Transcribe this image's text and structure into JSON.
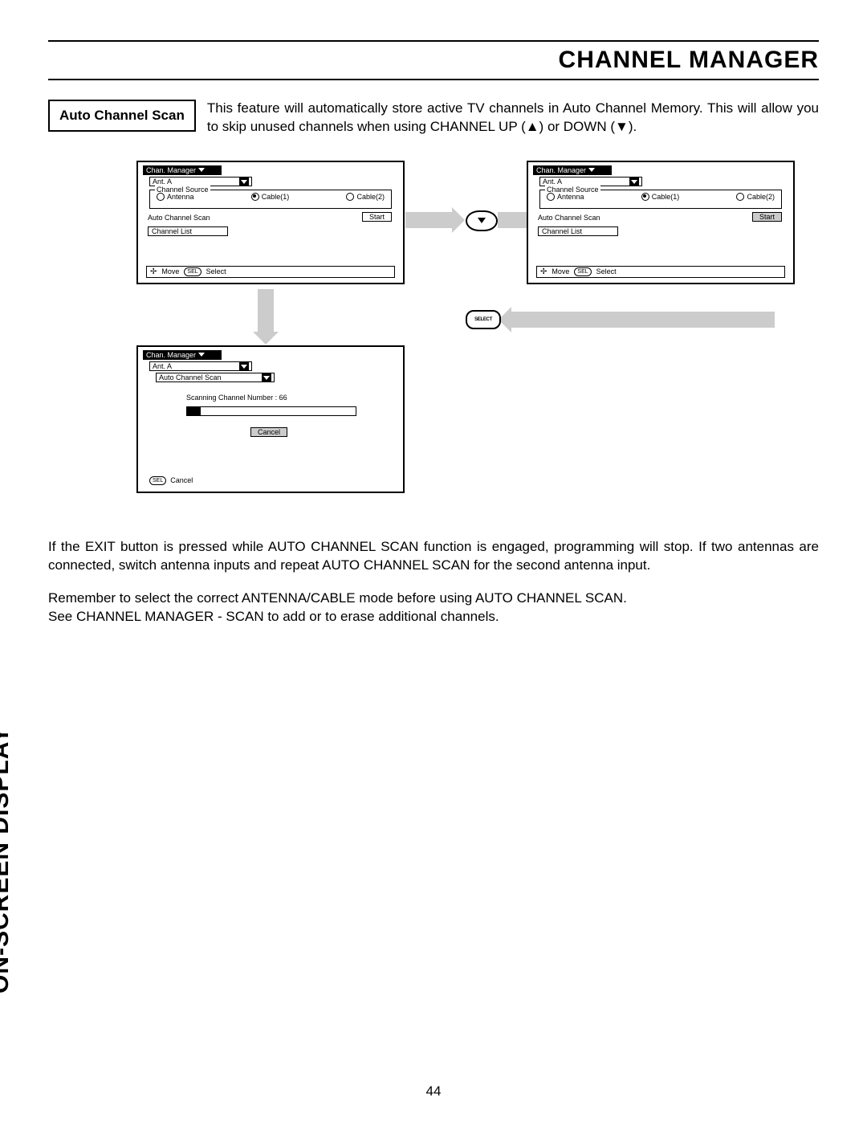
{
  "page": {
    "title": "CHANNEL MANAGER",
    "side_label": "ON-SCREEN DISPLAY",
    "page_number": "44"
  },
  "intro": {
    "feature_label": "Auto Channel Scan",
    "text": "This feature will automatically store active TV channels in Auto Channel Memory.  This will allow you to skip unused channels when using CHANNEL UP (▲) or DOWN (▼)."
  },
  "osd_common": {
    "tab": "Chan. Manager",
    "ant": "Ant. A",
    "source_legend": "Channel Source",
    "radios": {
      "antenna": "Antenna",
      "cable1": "Cable(1)",
      "cable2": "Cable(2)"
    },
    "auto_scan": "Auto Channel Scan",
    "start": "Start",
    "ch_list": "Channel List",
    "nav_move": "Move",
    "nav_sel": "SEL",
    "nav_select": "Select",
    "nav_cancel": "Cancel"
  },
  "osd3": {
    "sub2": "Auto Channel Scan",
    "scan_line": "Scanning Channel Number : 66",
    "cancel": "Cancel"
  },
  "remote": {
    "select_label": "SELECT"
  },
  "body": {
    "p1": "If the EXIT button is pressed while AUTO CHANNEL SCAN function is engaged, programming will stop.  If two antennas are connected, switch antenna inputs and repeat AUTO CHANNEL SCAN for the second antenna input.",
    "p2": "Remember to select the correct ANTENNA/CABLE mode before using AUTO CHANNEL SCAN.",
    "p3": "See CHANNEL MANAGER - SCAN to add or to erase additional channels."
  }
}
